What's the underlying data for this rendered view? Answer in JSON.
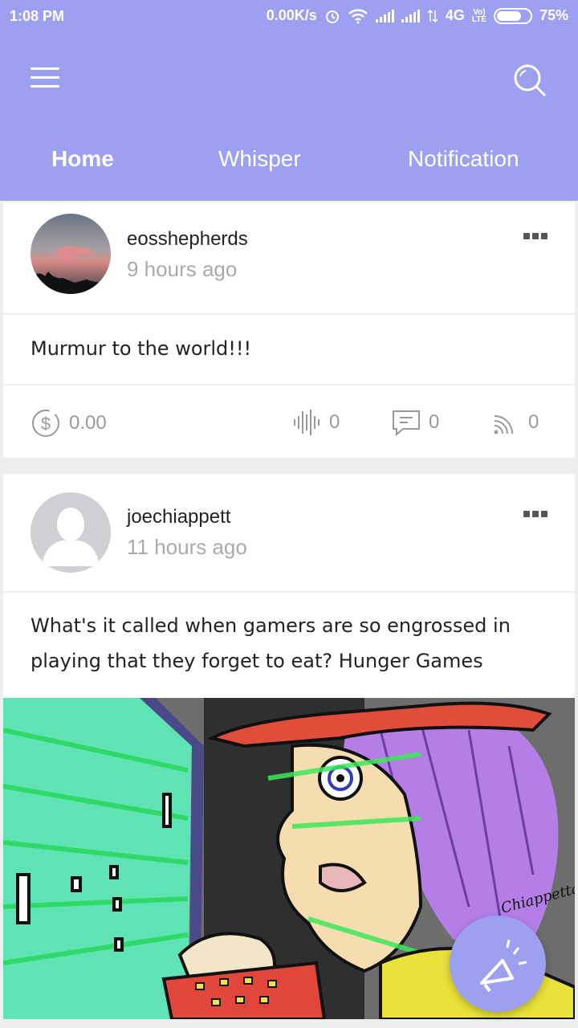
{
  "status_bar": {
    "time": "1:08 PM",
    "net_speed": "0.00K/s",
    "network": "4G",
    "volte": "Vo) LTE",
    "battery": "75%"
  },
  "app_bar": {
    "menu_icon": "hamburger-icon",
    "search_icon": "search-icon",
    "tabs": [
      {
        "label": "Home",
        "active": true
      },
      {
        "label": "Whisper",
        "active": false
      },
      {
        "label": "Notification",
        "active": false
      }
    ],
    "accent_color": "#9d9ff0"
  },
  "feed": {
    "posts": [
      {
        "username": "eosshepherds",
        "time_ago": "9 hours ago",
        "text": "Murmur to the world!!!",
        "stats": {
          "tips": "0.00",
          "murmurs": "0",
          "comments": "0",
          "shares": "0"
        }
      },
      {
        "username": "joechiappett",
        "time_ago": "11 hours ago",
        "text": "What's it called when gamers are so engrossed in playing that they forget to eat? Hunger Games",
        "image_signature": "Joe Chiappetta"
      }
    ]
  },
  "fab": {
    "icon": "megaphone-icon"
  }
}
